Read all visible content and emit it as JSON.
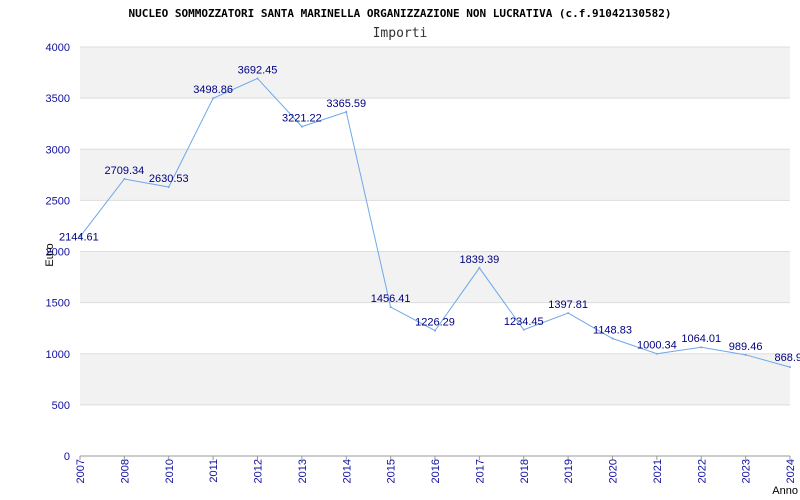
{
  "chart_data": {
    "type": "line",
    "title": "NUCLEO SOMMOZZATORI SANTA MARINELLA ORGANIZZAZIONE NON LUCRATIVA (c.f.91042130582)",
    "subtitle": "Importi",
    "xlabel": "Anno",
    "ylabel": "Euro",
    "ylim": [
      0,
      4000
    ],
    "yticks": [
      "0",
      "500",
      "1000",
      "1500",
      "2000",
      "2500",
      "3000",
      "3500",
      "4000"
    ],
    "x": [
      "2007",
      "2008",
      "2010",
      "2011",
      "2012",
      "2013",
      "2014",
      "2015",
      "2016",
      "2017",
      "2018",
      "2019",
      "2020",
      "2021",
      "2022",
      "2023",
      "2024"
    ],
    "values": [
      2144.61,
      2709.34,
      2630.53,
      3498.86,
      3692.45,
      3221.22,
      3365.59,
      1456.41,
      1226.29,
      1839.39,
      1234.45,
      1397.81,
      1148.83,
      1000.34,
      1064.01,
      989.46,
      868.9
    ],
    "data_labels": [
      "2144.61",
      "2709.34",
      "2630.53",
      "3498.86",
      "3692.45",
      "3221.22",
      "3365.59",
      "1456.41",
      "1226.29",
      "1839.39",
      "1234.45",
      "1397.81",
      "1148.83",
      "1000.34",
      "1064.01",
      "989.46",
      "868.9"
    ],
    "line_color": "#6fa8e8",
    "band_color": "#f2f2f2",
    "grid": true
  }
}
